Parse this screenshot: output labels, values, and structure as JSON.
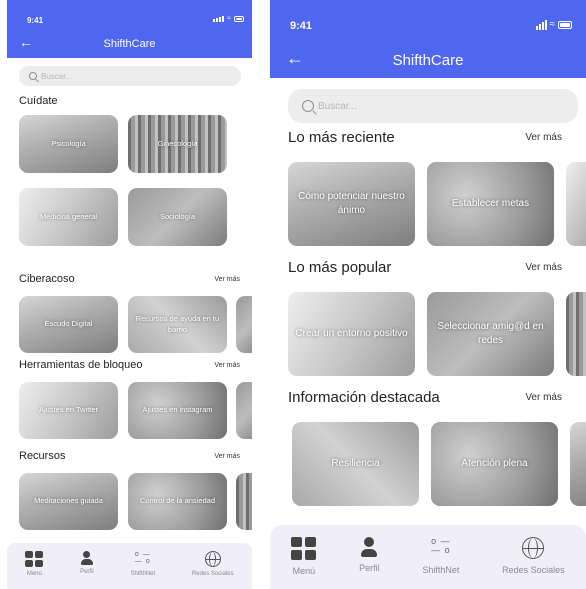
{
  "status": {
    "time": "9:41"
  },
  "header": {
    "title": "ShifthCare"
  },
  "search": {
    "placeholder": "Buscar..."
  },
  "screen1": {
    "sections": [
      {
        "title": "Cuídate",
        "more": "",
        "cards": [
          "Psicología",
          "Ginecología",
          "Medicina general",
          "Sociología"
        ]
      },
      {
        "title": "Ciberacoso",
        "more": "Ver más",
        "cards": [
          "Escudo Digital",
          "Recursos de ayuda en tu barrio"
        ]
      },
      {
        "title": "Herramientas de bloqueo",
        "more": "Ver más",
        "cards": [
          "Ajustes en Twitter",
          "Ajustes en instagram"
        ]
      },
      {
        "title": "Recursos",
        "more": "Ver más",
        "cards": [
          "Meditaciones guiada",
          "Control de la ansiedad"
        ]
      }
    ]
  },
  "screen2": {
    "sections": [
      {
        "title": "Lo más reciente",
        "more": "Ver más",
        "cards": [
          "Cómo potenciar nuestro ánimo",
          "Establecer metas"
        ]
      },
      {
        "title": "Lo más popular",
        "more": "Ver más",
        "cards": [
          "Crear un entorno positivo",
          "Seleccionar amig@d en redes"
        ]
      },
      {
        "title": "Información destacada",
        "more": "Ver más",
        "cards": [
          "Resiliencia",
          "Atención plena"
        ]
      }
    ]
  },
  "tabbar": {
    "items": [
      {
        "label": "Menú",
        "icon": "grid-icon"
      },
      {
        "label": "Perfil",
        "icon": "person-icon"
      },
      {
        "label": "ShifthNet",
        "icon": "sliders-icon"
      },
      {
        "label": "Redes Sociales",
        "icon": "globe-icon"
      }
    ]
  },
  "colors": {
    "accent": "#4f66ee",
    "tabbar": "#f0eef7",
    "search": "#ededed"
  }
}
